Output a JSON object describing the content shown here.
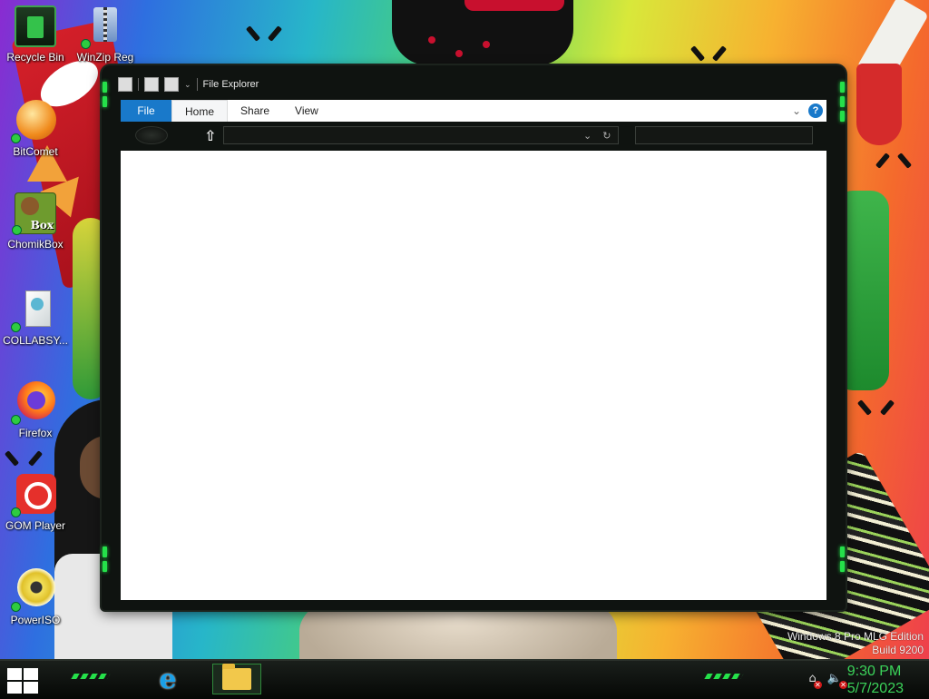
{
  "desktop": {
    "icons": [
      {
        "label": "Recycle Bin",
        "icon": "recycle-bin-icon"
      },
      {
        "label": "WinZip Reg",
        "icon": "winzip-icon"
      },
      {
        "label": "BitComet",
        "icon": "bitcomet-icon"
      },
      {
        "label": "ChomikBox",
        "icon": "chomikbox-icon",
        "icon_text": "Box"
      },
      {
        "label": "COLLABSY...",
        "icon": "collabsync-icon"
      },
      {
        "label": "Firefox",
        "icon": "firefox-icon"
      },
      {
        "label": "GOM Player",
        "icon": "gom-player-icon"
      },
      {
        "label": "PowerISO",
        "icon": "poweriso-icon"
      }
    ],
    "watermark": {
      "line1": "Windows 8 Pro MLG Edition",
      "line2": "Build 9200"
    }
  },
  "window": {
    "title": "File Explorer",
    "ribbon_tabs": [
      "File",
      "Home",
      "Share",
      "View"
    ],
    "help_label": "?",
    "address_value": "",
    "search_value": ""
  },
  "taskbar": {
    "clock_time": "9:30 PM",
    "clock_date": "5/7/2023",
    "pinned": [
      "internet-explorer-icon",
      "file-explorer-icon"
    ]
  },
  "colors": {
    "accent_green": "#25e04a",
    "ribbon_file_blue": "#1979ca",
    "clock_green": "#3bd35a"
  }
}
